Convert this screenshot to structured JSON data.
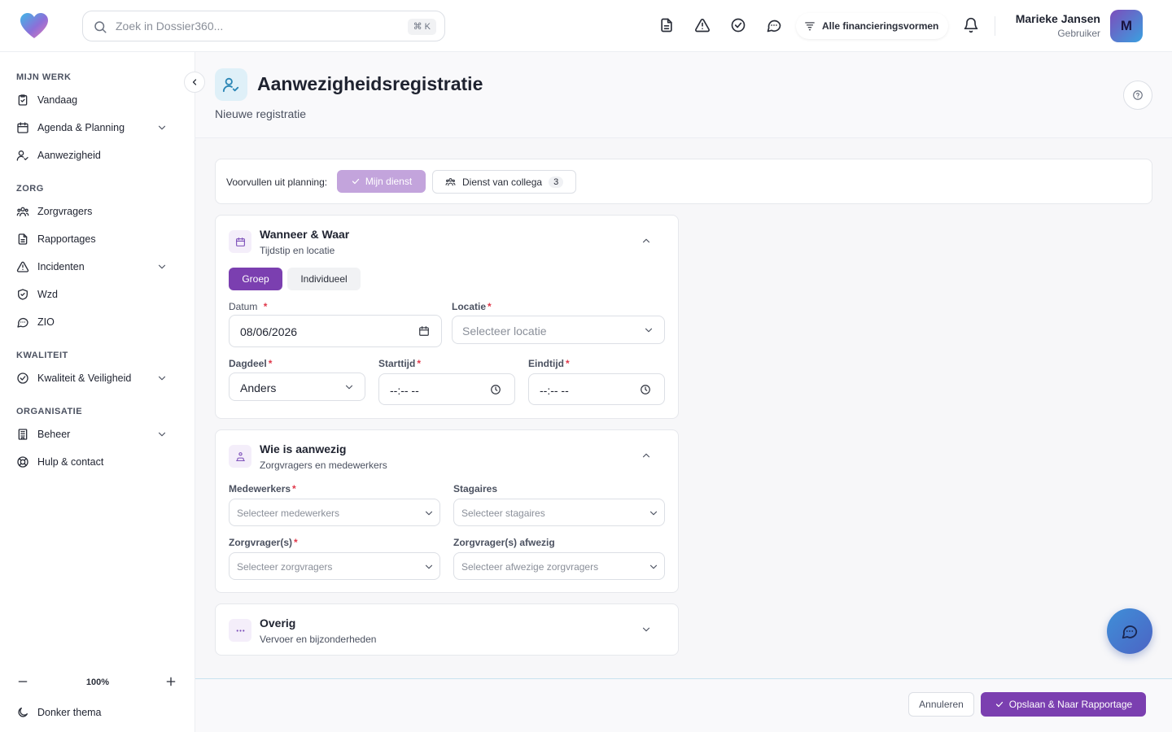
{
  "header": {
    "search_placeholder": "Zoek in Dossier360...",
    "search_shortcut": "⌘ K",
    "financing_label": "Alle financieringsvormen",
    "user_name": "Marieke Jansen",
    "user_role": "Gebruiker",
    "avatar_initial": "M"
  },
  "sidebar": {
    "sections": {
      "mijn_werk": "MIJN WERK",
      "zorg": "ZORG",
      "kwaliteit": "KWALITEIT",
      "organisatie": "ORGANISATIE"
    },
    "items": {
      "vandaag": "Vandaag",
      "agenda": "Agenda & Planning",
      "aanwezigheid": "Aanwezigheid",
      "zorgvragers": "Zorgvragers",
      "rapportages": "Rapportages",
      "incidenten": "Incidenten",
      "wzd": "Wzd",
      "zio": "ZIO",
      "kwaliteit": "Kwaliteit & Veiligheid",
      "beheer": "Beheer",
      "hulp": "Hulp & contact"
    },
    "zoom_level": "100%",
    "theme_label": "Donker thema"
  },
  "page": {
    "title": "Aanwezigheidsregistratie",
    "subtitle": "Nieuwe registratie"
  },
  "prefill": {
    "label": "Voorvullen uit planning:",
    "mijn_dienst": "Mijn dienst",
    "collega_dienst": "Dienst van collega",
    "collega_count": "3"
  },
  "card_when": {
    "title": "Wanneer & Waar",
    "subtitle": "Tijdstip en locatie",
    "tab_groep": "Groep",
    "tab_individueel": "Individueel",
    "datum_label": "Datum",
    "datum_value": "08/06/2026",
    "locatie_label": "Locatie",
    "locatie_placeholder": "Selecteer locatie",
    "dagdeel_label": "Dagdeel",
    "dagdeel_value": "Anders",
    "starttijd_label": "Starttijd",
    "starttijd_value": "--:-- --",
    "eindtijd_label": "Eindtijd",
    "eindtijd_value": "--:-- --",
    "required_mark": "*"
  },
  "card_who": {
    "title": "Wie is aanwezig",
    "subtitle": "Zorgvragers en medewerkers",
    "medewerkers_label": "Medewerkers",
    "medewerkers_placeholder": "Selecteer medewerkers",
    "stagaires_label": "Stagaires",
    "stagaires_placeholder": "Selecteer stagaires",
    "zorgvragers_label": "Zorgvrager(s)",
    "zorgvragers_placeholder": "Selecteer zorgvragers",
    "afwezig_label": "Zorgvrager(s) afwezig",
    "afwezig_placeholder": "Selecteer afwezige zorgvragers"
  },
  "card_other": {
    "title": "Overig",
    "subtitle": "Vervoer en bijzonderheden"
  },
  "footer": {
    "cancel": "Annuleren",
    "save": "Opslaan & Naar Rapportage"
  },
  "colors": {
    "primary": "#7b3fb0",
    "primary_light": "#c3a4dc",
    "required": "#e0384a",
    "title_icon_bg": "#dff0f8"
  }
}
